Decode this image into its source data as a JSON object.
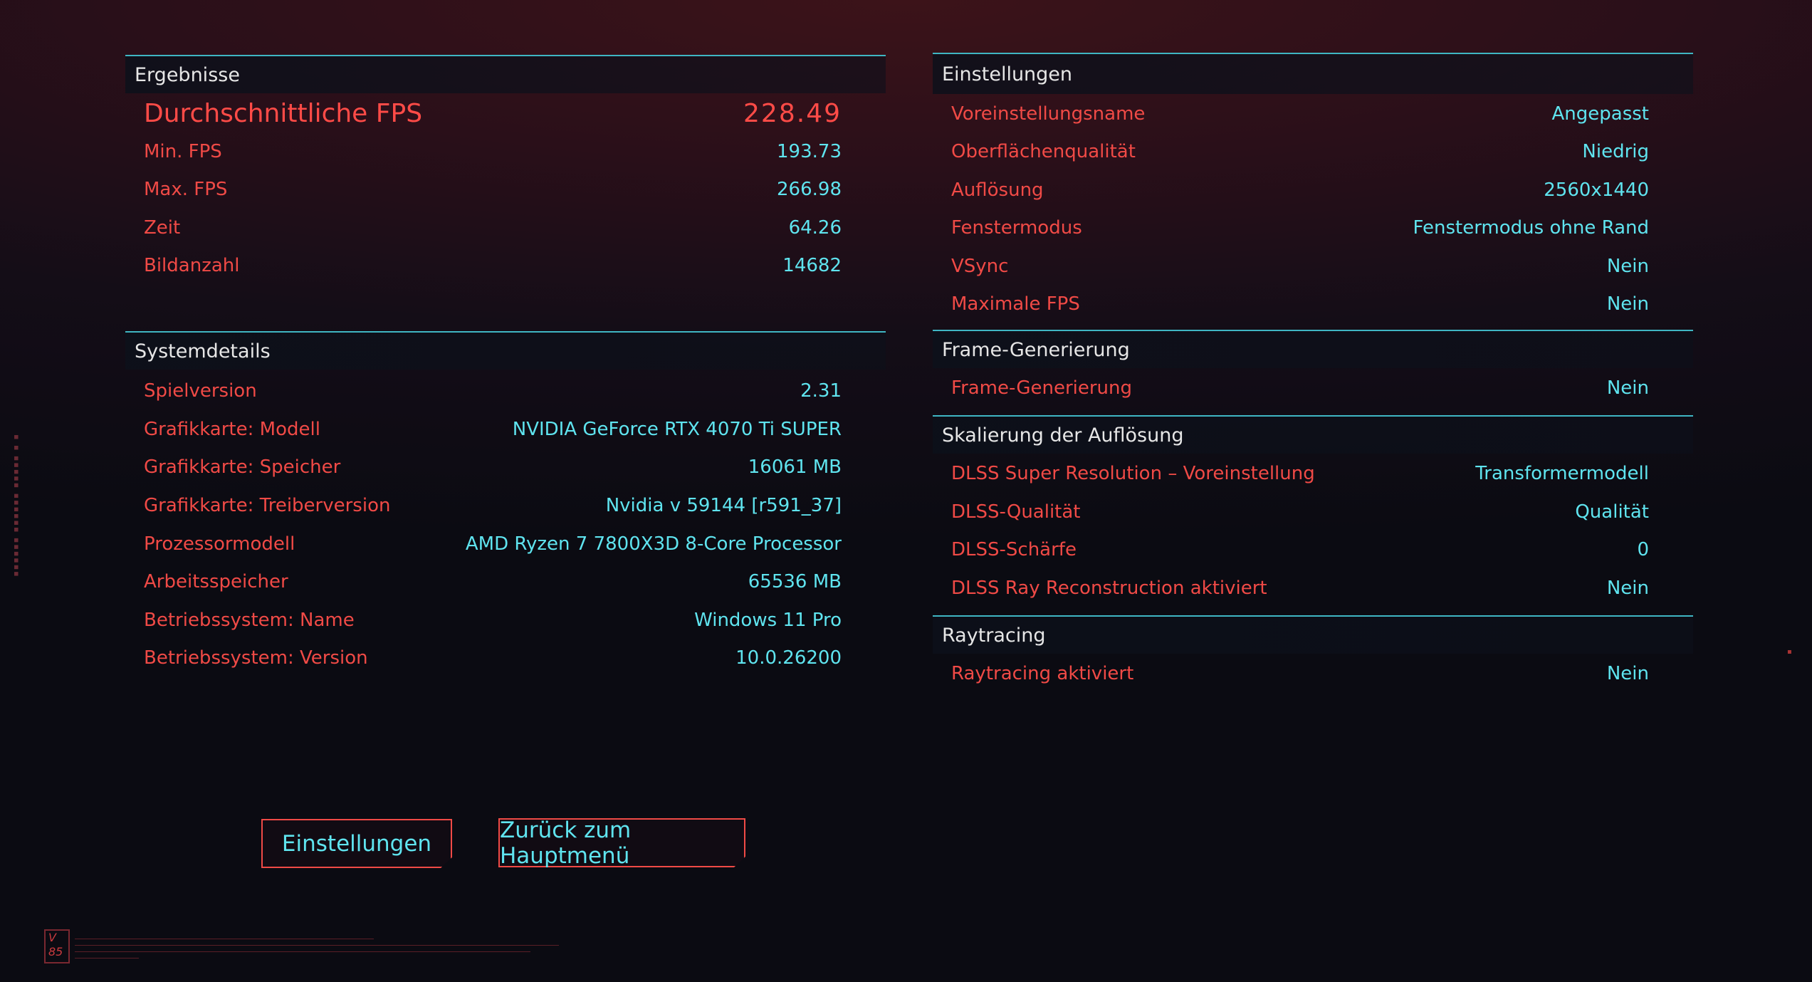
{
  "results": {
    "header": "Ergebnisse",
    "avg_fps_label": "Durchschnittliche FPS",
    "avg_fps_value": "228.49",
    "rows": [
      {
        "label": "Min. FPS",
        "value": "193.73"
      },
      {
        "label": "Max. FPS",
        "value": "266.98"
      },
      {
        "label": "Zeit",
        "value": "64.26"
      },
      {
        "label": "Bildanzahl",
        "value": "14682"
      }
    ]
  },
  "system": {
    "header": "Systemdetails",
    "rows": [
      {
        "label": "Spielversion",
        "value": "2.31"
      },
      {
        "label": "Grafikkarte: Modell",
        "value": "NVIDIA GeForce RTX 4070 Ti SUPER"
      },
      {
        "label": "Grafikkarte: Speicher",
        "value": "16061 MB"
      },
      {
        "label": "Grafikkarte: Treiberversion",
        "value": "Nvidia v 59144 [r591_37]"
      },
      {
        "label": "Prozessormodell",
        "value": "AMD Ryzen 7 7800X3D 8-Core Processor"
      },
      {
        "label": "Arbeitsspeicher",
        "value": "65536 MB"
      },
      {
        "label": "Betriebssystem: Name",
        "value": "Windows 11 Pro"
      },
      {
        "label": "Betriebssystem: Version",
        "value": "10.0.26200"
      }
    ]
  },
  "settings": {
    "header": "Einstellungen",
    "rows": [
      {
        "label": "Voreinstellungsname",
        "value": "Angepasst"
      },
      {
        "label": "Oberflächenqualität",
        "value": "Niedrig"
      },
      {
        "label": "Auflösung",
        "value": "2560x1440"
      },
      {
        "label": "Fenstermodus",
        "value": "Fenstermodus ohne Rand"
      },
      {
        "label": "VSync",
        "value": "Nein"
      },
      {
        "label": "Maximale FPS",
        "value": "Nein"
      }
    ]
  },
  "framegen": {
    "header": "Frame-Generierung",
    "rows": [
      {
        "label": "Frame-Generierung",
        "value": "Nein"
      }
    ]
  },
  "scaling": {
    "header": "Skalierung der Auflösung",
    "rows": [
      {
        "label": "DLSS Super Resolution – Voreinstellung",
        "value": "Transformermodell"
      },
      {
        "label": "DLSS-Qualität",
        "value": "Qualität"
      },
      {
        "label": "DLSS-Schärfe",
        "value": "0"
      },
      {
        "label": "DLSS Ray Reconstruction aktiviert",
        "value": "Nein"
      }
    ]
  },
  "raytracing": {
    "header": "Raytracing",
    "rows": [
      {
        "label": "Raytracing aktiviert",
        "value": "Nein"
      }
    ]
  },
  "buttons": {
    "settings": "Einstellungen",
    "main_menu": "Zurück zum Hauptmenü"
  },
  "footer": {
    "version_badge": "V 85"
  },
  "colors": {
    "label": "#f04a46",
    "value": "#5fe4ef",
    "accent_line": "#3fb6c3"
  }
}
